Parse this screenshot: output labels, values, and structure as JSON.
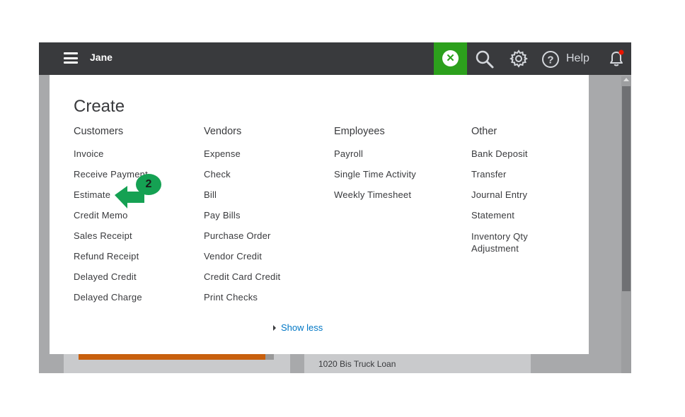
{
  "topbar": {
    "company_name": "Jane",
    "create_icon": "close-x-icon",
    "search_icon": "search-icon",
    "settings_icon": "gear-icon",
    "help_icon": "question-circle-icon",
    "help_label": "Help",
    "notifications_icon": "bell-icon"
  },
  "create_panel": {
    "title": "Create",
    "columns": [
      {
        "heading": "Customers",
        "items": [
          "Invoice",
          "Receive Payment",
          "Estimate",
          "Credit Memo",
          "Sales Receipt",
          "Refund Receipt",
          "Delayed Credit",
          "Delayed Charge"
        ]
      },
      {
        "heading": "Vendors",
        "items": [
          "Expense",
          "Check",
          "Bill",
          "Pay Bills",
          "Purchase Order",
          "Vendor Credit",
          "Credit Card Credit",
          "Print Checks"
        ]
      },
      {
        "heading": "Employees",
        "items": [
          "Payroll",
          "Single Time Activity",
          "Weekly Timesheet"
        ]
      },
      {
        "heading": "Other",
        "items": [
          "Bank Deposit",
          "Transfer",
          "Journal Entry",
          "Statement",
          "Inventory Qty Adjustment"
        ]
      }
    ],
    "show_less": "Show less"
  },
  "annotation": {
    "step_number": "2"
  },
  "background": {
    "account_label": "1020 Bis Truck Loan"
  },
  "colors": {
    "topbar": "#393a3d",
    "create_button": "#2ca01c",
    "link": "#0077c5",
    "annotation": "#15a153",
    "notification_dot": "#e81500"
  }
}
